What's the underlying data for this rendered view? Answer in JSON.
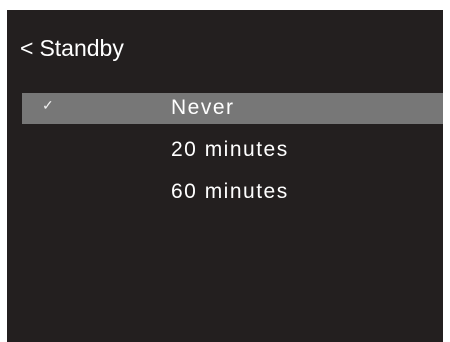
{
  "header": {
    "back_glyph": "<",
    "title": "Standby"
  },
  "options": [
    {
      "label": "Never",
      "selected": true,
      "check": "✓"
    },
    {
      "label": "20 minutes",
      "selected": false,
      "check": ""
    },
    {
      "label": "60 minutes",
      "selected": false,
      "check": ""
    }
  ],
  "colors": {
    "background": "#231f1f",
    "selected_row": "#777777",
    "text": "#ffffff"
  }
}
